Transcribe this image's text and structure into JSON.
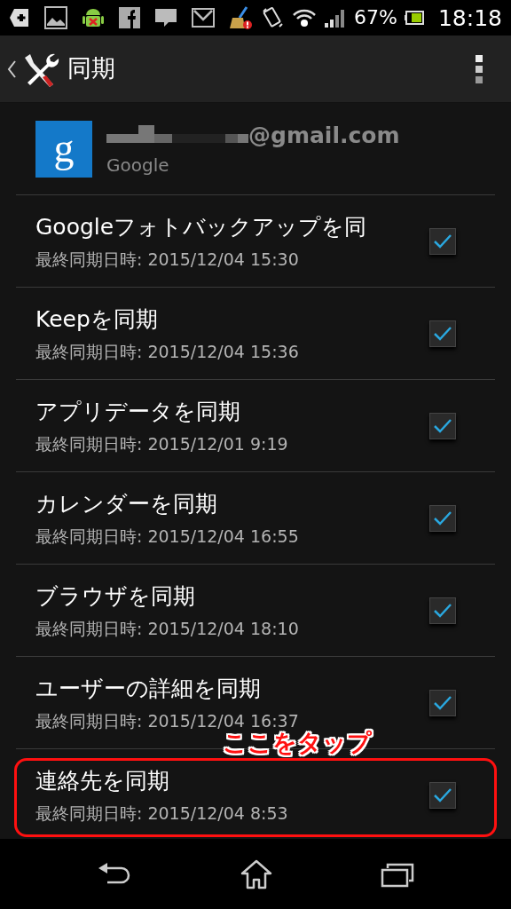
{
  "status_bar": {
    "battery_percent": "67%",
    "time": "18:18"
  },
  "action_bar": {
    "title": "同期"
  },
  "account": {
    "logo_letter": "g",
    "email": "@gmail.com",
    "type": "Google"
  },
  "sync_items": [
    {
      "title": "Googleフォトバックアップを同",
      "subtitle": "最終同期日時: 2015/12/04 15:30",
      "checked": true,
      "highlighted": false
    },
    {
      "title": "Keepを同期",
      "subtitle": "最終同期日時: 2015/12/04 15:36",
      "checked": true,
      "highlighted": false
    },
    {
      "title": "アプリデータを同期",
      "subtitle": "最終同期日時: 2015/12/01 9:19",
      "checked": true,
      "highlighted": false
    },
    {
      "title": "カレンダーを同期",
      "subtitle": "最終同期日時: 2015/12/04 16:55",
      "checked": true,
      "highlighted": false
    },
    {
      "title": "ブラウザを同期",
      "subtitle": "最終同期日時: 2015/12/04 18:10",
      "checked": true,
      "highlighted": false
    },
    {
      "title": "ユーザーの詳細を同期",
      "subtitle": "最終同期日時: 2015/12/04 16:37",
      "checked": true,
      "highlighted": false
    },
    {
      "title": "連絡先を同期",
      "subtitle": "最終同期日時: 2015/12/04 8:53",
      "checked": true,
      "highlighted": true
    }
  ],
  "callout": {
    "text": "ここをタップ"
  }
}
